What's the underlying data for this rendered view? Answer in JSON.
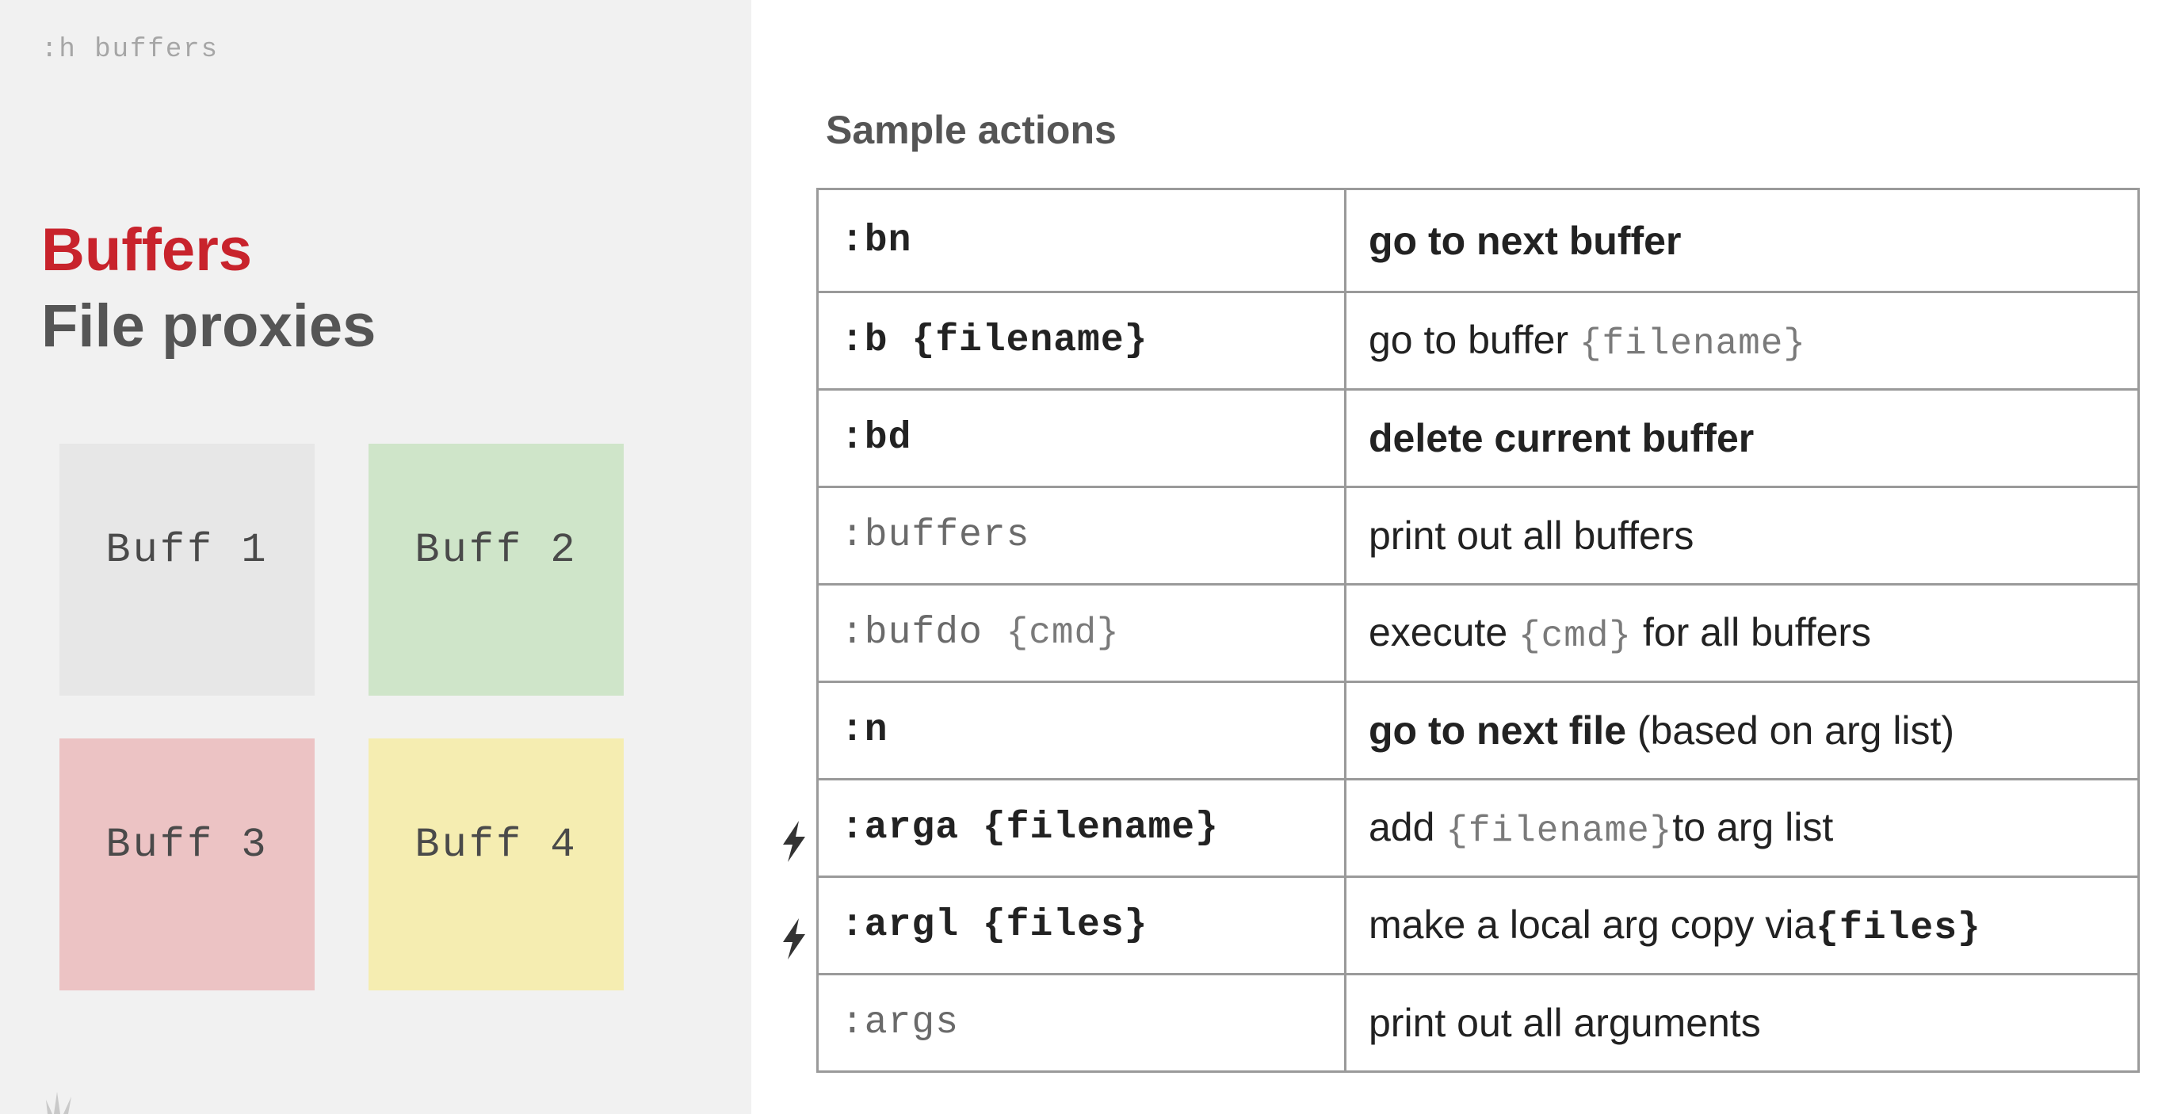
{
  "help_command": ":h buffers",
  "title": {
    "primary": "Buffers",
    "secondary": "File proxies"
  },
  "buffers": [
    {
      "label": "Buff 1",
      "color": "#e7e7e7"
    },
    {
      "label": "Buff 2",
      "color": "#cfe5c9"
    },
    {
      "label": "Buff 3",
      "color": "#ecc3c4"
    },
    {
      "label": "Buff 4",
      "color": "#f5edb1"
    }
  ],
  "colors": {
    "accent_red": "#c8232c",
    "heading_gray": "#555555",
    "table_border": "#9a9a9a"
  },
  "section_title": "Sample actions",
  "rows": [
    {
      "command": ":bn",
      "description": "go to next buffer"
    },
    {
      "command": ":b {filename}",
      "description_prefix": "go to buffer ",
      "description_code": "{filename}"
    },
    {
      "command": ":bd",
      "description": "delete current buffer"
    },
    {
      "command": ":buffers",
      "description": "print out all buffers"
    },
    {
      "command_prefix": ":bufdo ",
      "command_code": "{cmd}",
      "description_prefix": "execute ",
      "description_code": "{cmd}",
      "description_suffix": " for all buffers"
    },
    {
      "command": ":n",
      "description_bold": "go to next file",
      "description_suffix": " (based on arg list)"
    },
    {
      "command": ":arga {filename}",
      "marker": "lightning-bolt-icon",
      "description_prefix": "add ",
      "description_code": "{filename}",
      "description_suffix": "to arg list"
    },
    {
      "command": ":argl {files}",
      "marker": "lightning-bolt-icon",
      "description_prefix": "make a local arg copy via",
      "description_code": "{files}"
    },
    {
      "command": ":args",
      "description": "print out all arguments"
    }
  ]
}
